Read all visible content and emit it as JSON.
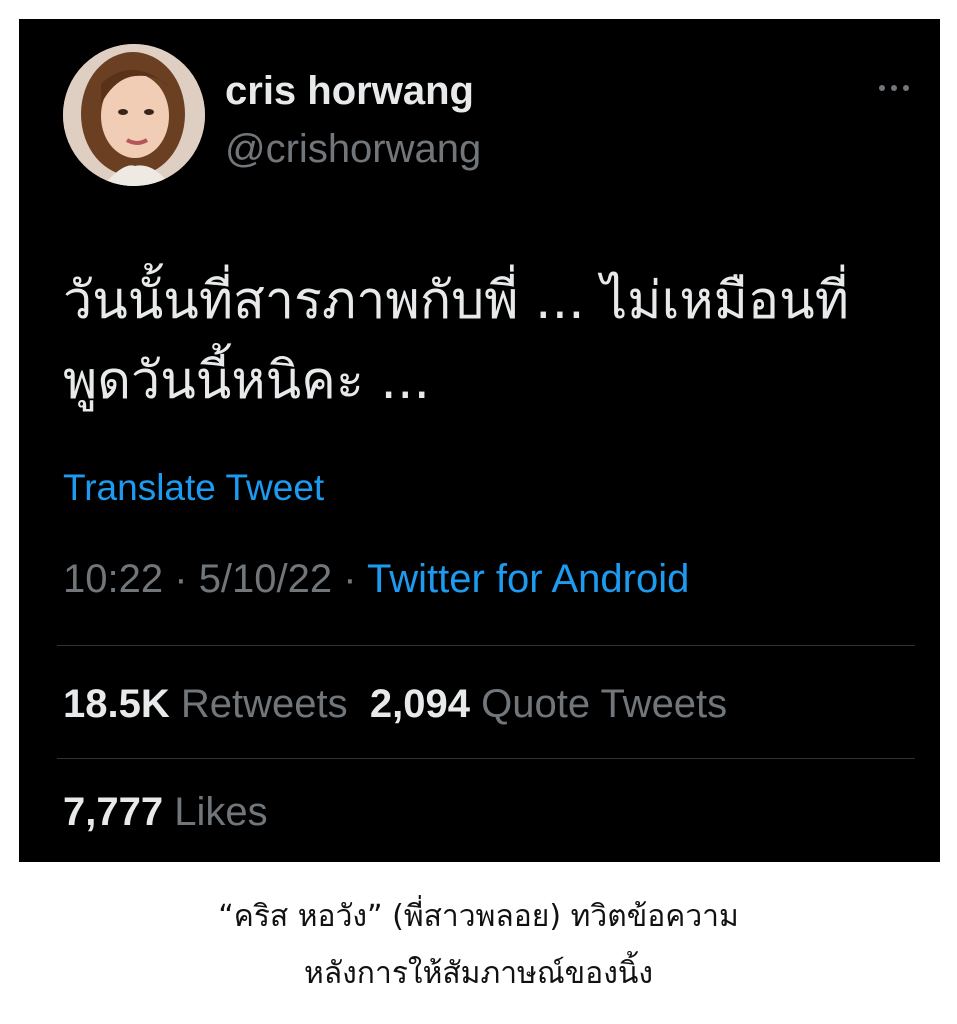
{
  "tweet": {
    "display_name": "cris horwang",
    "handle": "@crishorwang",
    "text_lines": [
      "วันนั้นที่สารภาพกับพี่ ... ไม่เหมือนที่",
      "พูดวันนี้หนิคะ ..."
    ],
    "translate_label": "Translate Tweet",
    "time": "10:22",
    "date": "5/10/22",
    "separator": "·",
    "source": "Twitter for Android",
    "stats": {
      "retweets_count": "18.5K",
      "retweets_label": "Retweets",
      "quote_count": "2,094",
      "quote_label": "Quote Tweets",
      "likes_count": "7,777",
      "likes_label": "Likes"
    },
    "icons": {
      "more": "more-horizontal-icon",
      "avatar": "profile-photo"
    }
  },
  "caption": {
    "line1": "“คริส หอวัง” (พี่สาวพลอย) ทวิตข้อความ",
    "line2": "หลังการให้สัมภาษณ์ของนิ้ง"
  },
  "colors": {
    "background": "#000000",
    "text_primary": "#e7e9ea",
    "text_secondary": "#71767b",
    "link": "#1d9bf0",
    "divider": "#2f3336",
    "page": "#ffffff"
  }
}
